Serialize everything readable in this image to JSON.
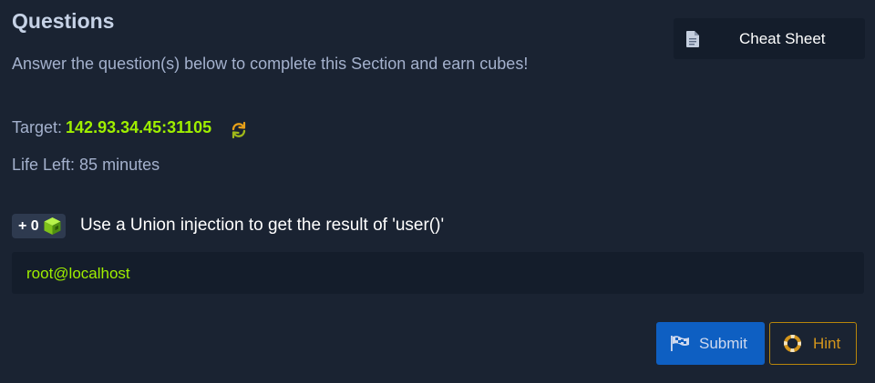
{
  "section": {
    "title": "Questions",
    "subtitle": "Answer the question(s) below to complete this Section and earn cubes!"
  },
  "cheat_sheet": {
    "label": "Cheat Sheet",
    "icon": "document-icon"
  },
  "target": {
    "label": "Target:",
    "value": "142.93.34.45:31105",
    "refresh_icon": "refresh-icon"
  },
  "life": {
    "text": "Life Left: 85 minutes"
  },
  "question": {
    "points": "+ 0",
    "cube_icon": "cube-icon",
    "text": "Use a Union injection to get the result of 'user()'"
  },
  "answer": {
    "value": "root@localhost"
  },
  "actions": {
    "submit_label": "Submit",
    "submit_icon": "flag-icon",
    "hint_label": "Hint",
    "hint_icon": "lifebuoy-icon"
  },
  "colors": {
    "background": "#1a2332",
    "panel": "#141d2b",
    "accent_green": "#9fef00",
    "submit_blue": "#0e5fc2",
    "hint_gold": "#d4961c"
  }
}
